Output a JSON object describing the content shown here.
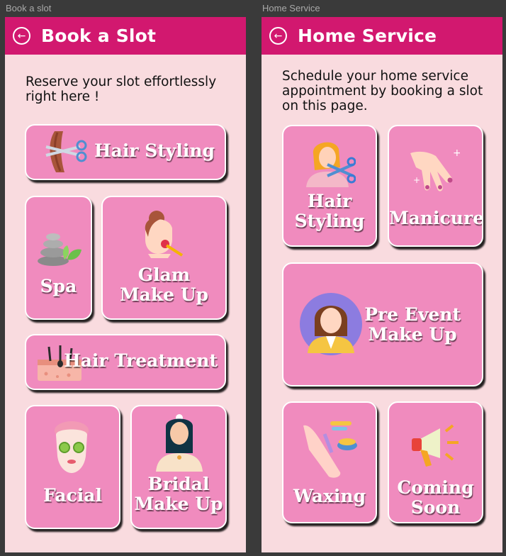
{
  "left_frame": {
    "frame_label": "Book a slot",
    "title": "Book a Slot",
    "back_icon": "arrow-left-circle-icon",
    "subtitle": "Reserve your slot effortlessly right here !",
    "cards": {
      "hair_styling": "Hair Styling",
      "spa": "Spa",
      "glam_makeup": "Glam\nMake Up",
      "hair_treatment": "Hair Treatment",
      "facial": "Facial",
      "bridal_makeup": "Bridal\nMake Up"
    }
  },
  "right_frame": {
    "frame_label": "Home Service",
    "title": "Home Service",
    "back_icon": "arrow-left-circle-icon",
    "subtitle": "Schedule your home service appointment by booking a slot on this page.",
    "cards": {
      "hair_styling": "Hair\nStyling",
      "manicure": "Manicure",
      "pre_event_makeup": "Pre Event\nMake Up",
      "waxing": "Waxing",
      "coming_soon": "Coming\nSoon"
    }
  },
  "colors": {
    "app_bar": "#d2186f",
    "page_background": "#f9dbdf",
    "card_fill": "#f08bbe",
    "card_border": "#ffffff"
  }
}
